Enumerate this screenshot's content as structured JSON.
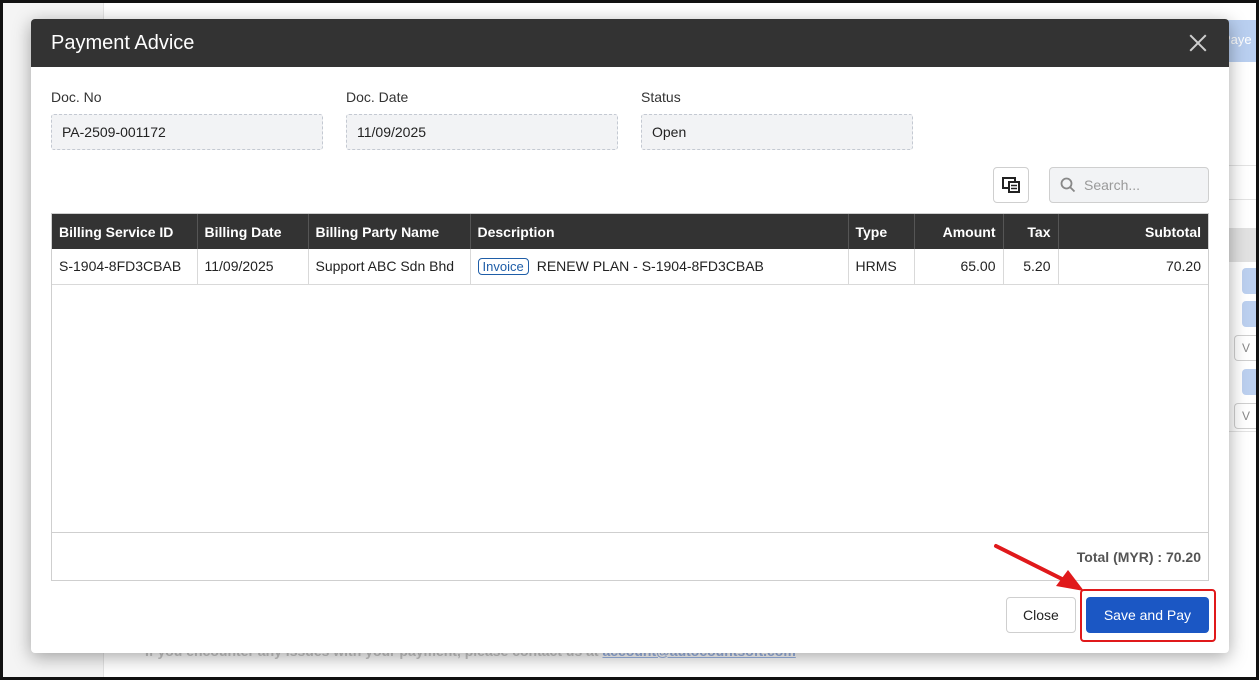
{
  "background": {
    "tab_fragment": "Paye",
    "v_label": "V",
    "footer_text": "If you encounter any issues with your payment, please contact us at",
    "footer_link": "account@autocountsoft.com"
  },
  "modal": {
    "title": "Payment Advice",
    "fields": {
      "doc_no_label": "Doc. No",
      "doc_no_value": "PA-2509-001172",
      "doc_date_label": "Doc. Date",
      "doc_date_value": "11/09/2025",
      "status_label": "Status",
      "status_value": "Open"
    },
    "search": {
      "placeholder": "Search..."
    },
    "table": {
      "columns": [
        "Billing Service ID",
        "Billing Date",
        "Billing Party Name",
        "Description",
        "Type",
        "Amount",
        "Tax",
        "Subtotal"
      ],
      "rows": [
        {
          "billing_service_id": "S-1904-8FD3CBAB",
          "billing_date": "11/09/2025",
          "billing_party_name": "Support ABC Sdn Bhd",
          "badge": "Invoice",
          "description": "RENEW PLAN - S-1904-8FD3CBAB",
          "type": "HRMS",
          "amount": "65.00",
          "tax": "5.20",
          "subtotal": "70.20"
        }
      ],
      "total": "Total (MYR) : 70.20"
    },
    "buttons": {
      "close": "Close",
      "save_and_pay": "Save and Pay"
    }
  },
  "colors": {
    "header_bg": "#333333",
    "primary_button": "#1b57c4",
    "highlight": "#e0191b",
    "badge": "#1f5ea8"
  }
}
